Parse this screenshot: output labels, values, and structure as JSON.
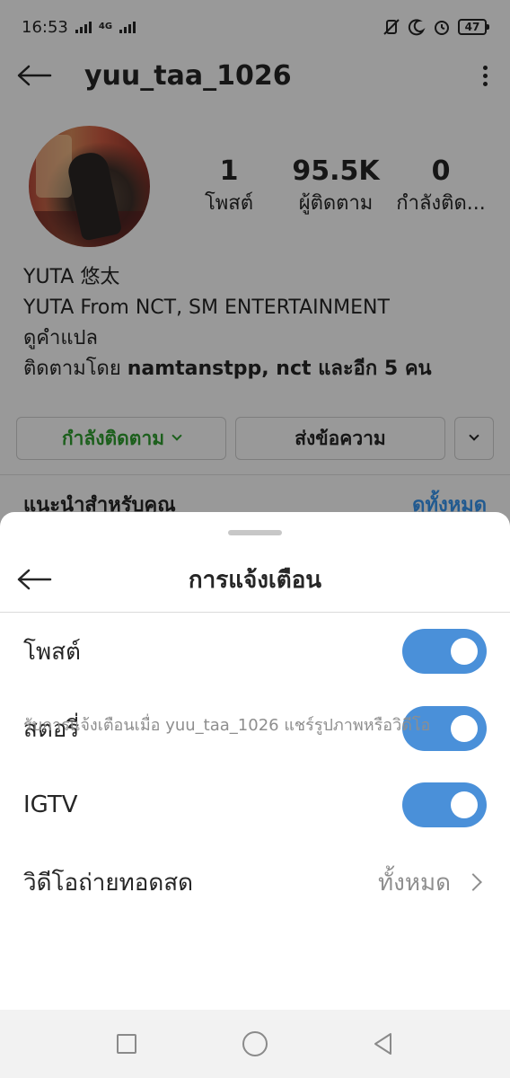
{
  "status_bar": {
    "time": "16:53",
    "network": "4G",
    "battery": "47",
    "icons": [
      "signal-icon",
      "mute-icon",
      "moon-icon",
      "alarm-icon",
      "battery-icon"
    ]
  },
  "profile": {
    "username": "yuu_taa_1026",
    "stats": [
      {
        "value": "1",
        "label": "โพสต์"
      },
      {
        "value": "95.5K",
        "label": "ผู้ติดตาม"
      },
      {
        "value": "0",
        "label": "กำลังติด..."
      }
    ],
    "bio": {
      "name": "YUTA 悠太",
      "description": "YUTA From NCT, SM ENTERTAINMENT",
      "translate": "ดูคำแปล",
      "followed_by_prefix": "ติดตามโดย ",
      "followed_by_names": "namtanstpp, nct",
      "followed_by_suffix": " และอีก 5 คน"
    },
    "actions": {
      "following": "กำลังติดตาม",
      "message": "ส่งข้อความ"
    },
    "suggest": {
      "title": "แนะนำสำหรับคุณ",
      "see_all": "ดูทั้งหมด"
    }
  },
  "sheet": {
    "title": "การแจ้งเตือน",
    "rows": [
      {
        "label": "โพสต์",
        "enabled": true
      },
      {
        "label": "สตอรี่",
        "enabled": true
      },
      {
        "label": "IGTV",
        "enabled": true
      }
    ],
    "live": {
      "label": "วิดีโอถ่ายทอดสด",
      "value": "ทั้งหมด"
    },
    "footer": "รับการแจ้งเตือนเมื่อ yuu_taa_1026 แชร์รูปภาพหรือวิดีโอ"
  },
  "colors": {
    "toggle_on": "#4a90d9",
    "following_green": "#2f9e2f",
    "link_blue": "#3897f0"
  }
}
